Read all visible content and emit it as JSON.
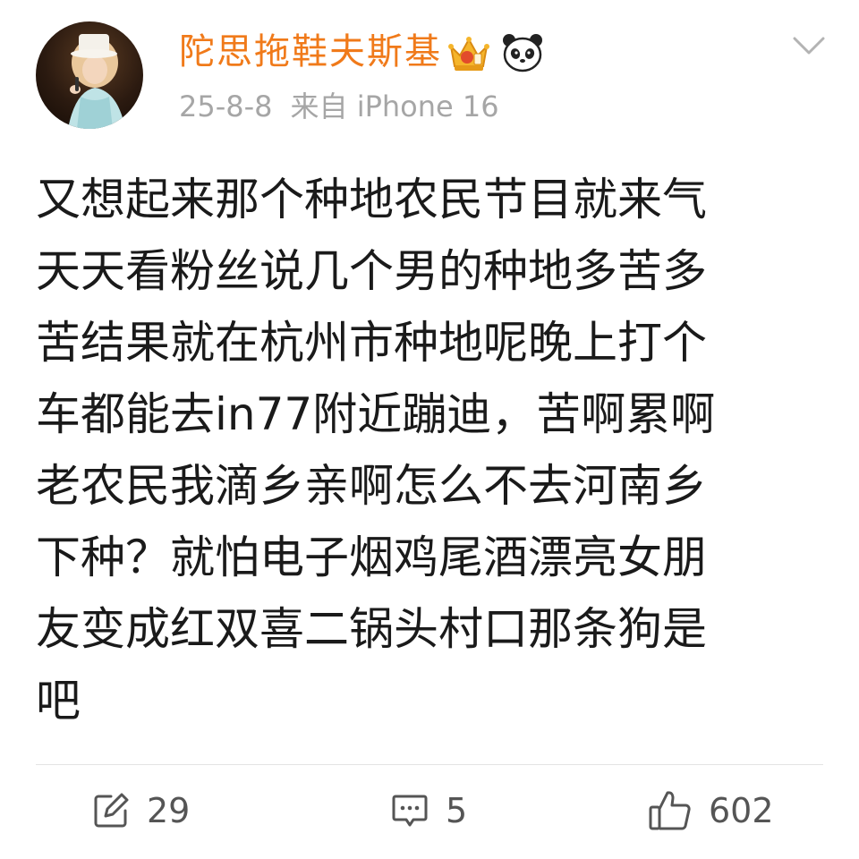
{
  "post": {
    "username": "陀思拖鞋夫斯基",
    "date": "25-8-8",
    "source": "来自 iPhone 16",
    "text_lines": [
      "又想起来那个种地农民节目就来气",
      "天天看粉丝说几个男的种地多苦多",
      "苦结果就在杭州市种地呢晚上打个",
      "车都能去in77附近蹦迪，苦啊累啊",
      "老农民我滴乡亲啊怎么不去河南乡",
      "下种？就怕电子烟鸡尾酒漂亮女朋",
      "友变成红双喜二锅头村口那条狗是",
      "吧"
    ],
    "badges": [
      "crown-vip-icon",
      "panda-icon"
    ]
  },
  "actions": {
    "repost_count": "29",
    "comment_count": "5",
    "like_count": "602"
  },
  "colors": {
    "username": "#f07a1a",
    "meta": "#a6a6a6",
    "text": "#1a1a1a",
    "icon": "#555555"
  },
  "icons": {
    "menu": "chevron-down-icon",
    "repost": "repost-icon",
    "comment": "comment-icon",
    "like": "thumbs-up-icon"
  }
}
